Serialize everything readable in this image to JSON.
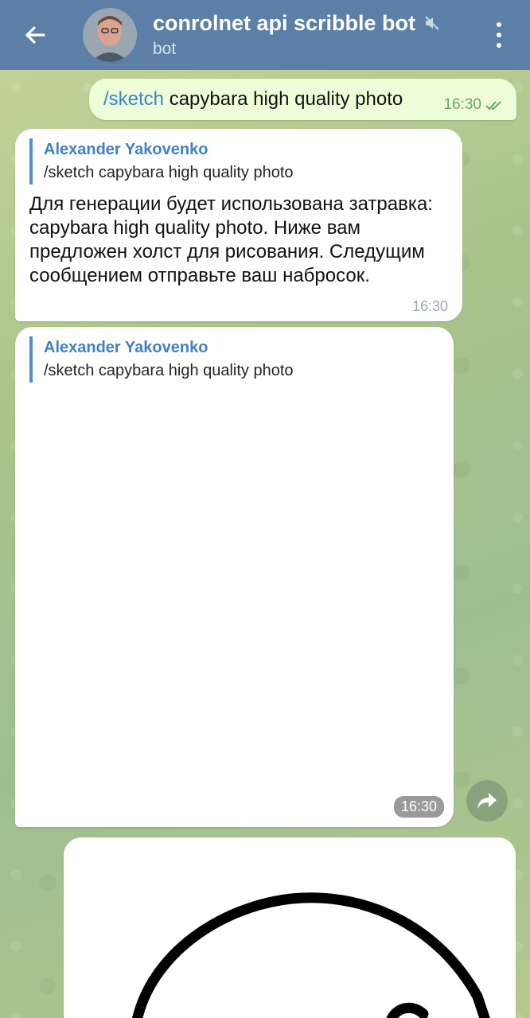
{
  "header": {
    "title": "conrolnet api scribble bot",
    "subtitle": "bot",
    "icons": [
      "back-arrow-icon",
      "mute-icon",
      "more-vertical-icon"
    ],
    "colors": {
      "bar": "#5b7fa6"
    }
  },
  "messages": {
    "outgoing": {
      "command": "/sketch",
      "text": " capybara high quality photo",
      "time": "16:30",
      "status": "read"
    },
    "reply1": {
      "reply_name": "Alexander Yakovenko",
      "reply_text": "/sketch capybara high quality photo",
      "text": "Для генерации будет использована затравка: capybara high quality photo. Ниже вам предложен холст для рисования. Следущим сообщением отправьте ваш набросок.",
      "time": "16:30"
    },
    "reply2": {
      "reply_name": "Alexander Yakovenko",
      "reply_text": "/sketch capybara high quality photo",
      "time": "16:30"
    }
  },
  "colors": {
    "outgoing_bubble": "#eefed9",
    "link": "#3a86c8",
    "reply_accent": "#4f8fcb"
  }
}
